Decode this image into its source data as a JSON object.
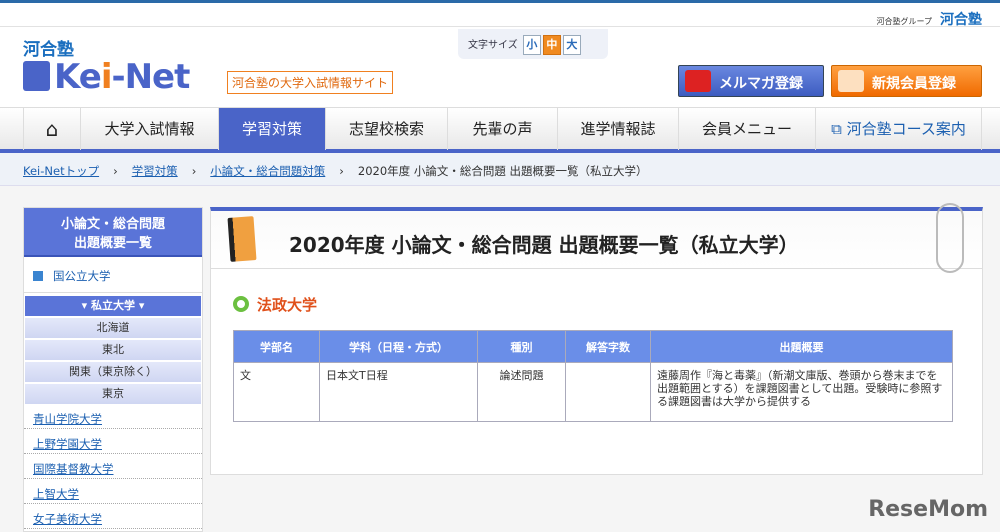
{
  "top": {
    "group_label": "河合塾グループ",
    "group_logo": "河合塾"
  },
  "header": {
    "logo_top": "河合塾",
    "logo_a": "Ke",
    "logo_i": "i",
    "logo_b": "-Net",
    "tagline": "河合塾の大学入試情報サイト",
    "font_size": {
      "label": "文字サイズ",
      "small": "小",
      "medium": "中",
      "large": "大",
      "selected": "中"
    },
    "mail_button": "メルマガ登録",
    "register_button": "新規会員登録"
  },
  "nav": {
    "home_icon": "home-icon",
    "items": [
      "大学入試情報",
      "学習対策",
      "志望校検索",
      "先輩の声",
      "進学情報誌",
      "会員メニュー",
      "河合塾コース案内"
    ],
    "active": "学習対策"
  },
  "breadcrumb": [
    "Kei-Netトップ",
    "学習対策",
    "小論文・総合問題対策",
    "2020年度 小論文・総合問題 出題概要一覧（私立大学）"
  ],
  "sidebar": {
    "title1": "小論文・総合問題",
    "title2": "出題概要一覧",
    "national": "国公立大学",
    "private": "▾ 私立大学 ▾",
    "regions": [
      "北海道",
      "東北",
      "関東（東京除く）",
      "東京"
    ],
    "universities": [
      "青山学院大学",
      "上野学園大学",
      "国際基督教大学",
      "上智大学",
      "女子美術大学"
    ]
  },
  "main": {
    "title": "2020年度 小論文・総合問題 出題概要一覧（私立大学）",
    "university": "法政大学",
    "table": {
      "headers": [
        "学部名",
        "学科（日程・方式）",
        "種別",
        "解答字数",
        "出題概要"
      ],
      "rows": [
        [
          "文",
          "日本文T日程",
          "論述問題",
          "",
          "遠藤周作『海と毒薬』（新潮文庫版、巻頭から巻末までを出題範囲とする）を課題図書として出題。受験時に参照する課題図書は大学から提供する"
        ]
      ]
    }
  },
  "watermark": "ReseMom"
}
